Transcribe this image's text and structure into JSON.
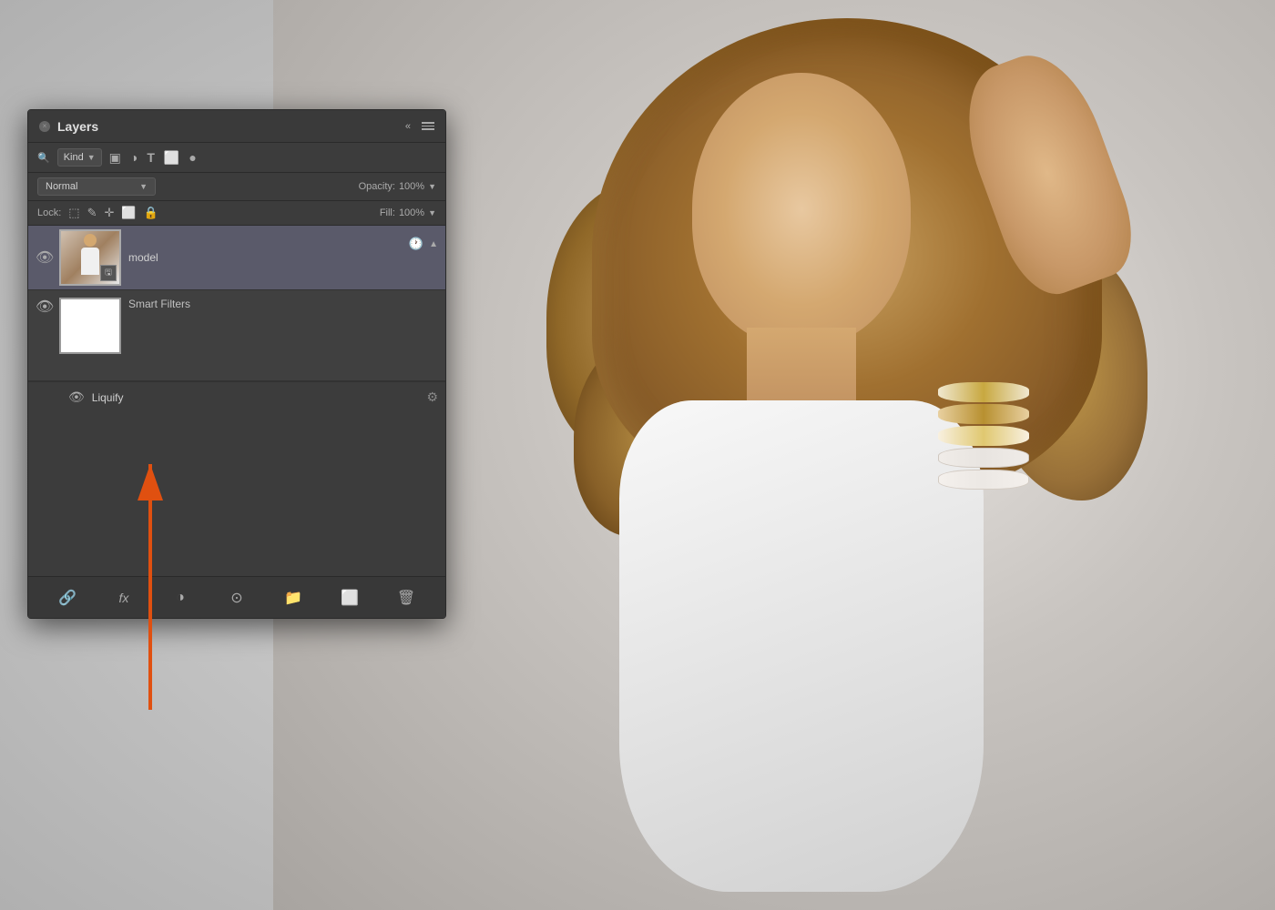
{
  "panel": {
    "title": "Layers",
    "close_label": "×",
    "collapse_label": "«",
    "menu_label": "≡"
  },
  "filter_bar": {
    "kind_label": "Kind",
    "search_icon": "🔍",
    "pixel_icon": "▣",
    "adjustment_icon": "◑",
    "type_icon": "T",
    "shape_icon": "⬜",
    "smart_icon": "●"
  },
  "blend_mode": {
    "value": "Normal",
    "opacity_label": "Opacity:",
    "opacity_value": "100%",
    "fill_label": "Fill:",
    "fill_value": "100%"
  },
  "lock": {
    "label": "Lock:",
    "transparent_icon": "⬚",
    "paint_icon": "✎",
    "move_icon": "✛",
    "artboard_icon": "⬜",
    "lock_icon": "🔒"
  },
  "layers": [
    {
      "id": "model",
      "name": "model",
      "visible": true,
      "selected": true,
      "type": "smart_object",
      "has_smart_filter_badge": true
    }
  ],
  "smart_filters": {
    "label": "Smart Filters",
    "visible": true
  },
  "liquify": {
    "name": "Liquify",
    "visible": true
  },
  "toolbar": {
    "link_icon": "🔗",
    "fx_label": "fx",
    "adjustment_icon": "◑",
    "mask_circle_icon": "⊙",
    "folder_icon": "📁",
    "artboard_icon": "⬜",
    "trash_icon": "🗑"
  },
  "arrow": {
    "color": "#e05010"
  }
}
